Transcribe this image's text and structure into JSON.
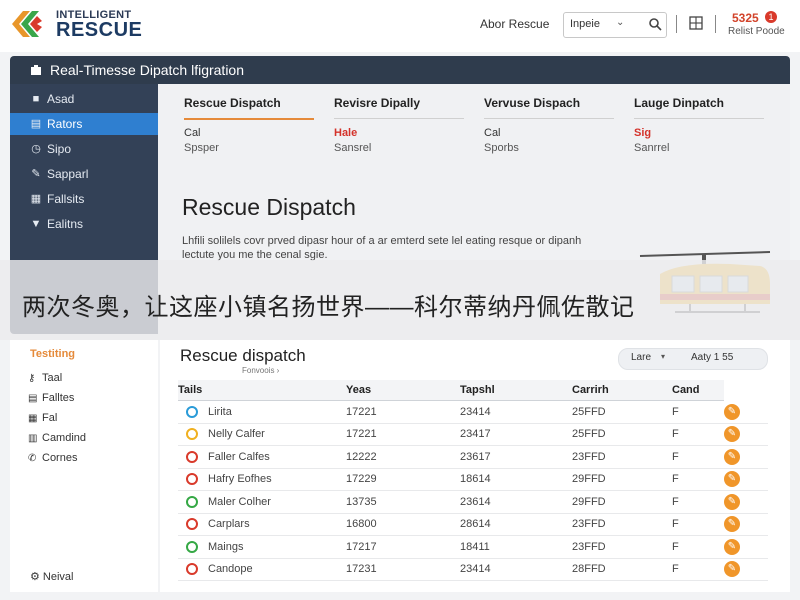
{
  "header": {
    "brand_top": "INTELLIGENT",
    "brand_main": "RESCUE",
    "about": "Abor Rescue",
    "search_select": "Inpeie",
    "stat_value": "5325",
    "stat_badge": "1",
    "stat_sub": "Relist Poode"
  },
  "panel": {
    "title": "Real-Timesse Dipatch lfigration"
  },
  "sidebar": {
    "items": [
      {
        "icon": "folder-icon",
        "glyph": "■",
        "label": "Asad"
      },
      {
        "icon": "dashboard-icon",
        "glyph": "▤",
        "label": "Rators"
      },
      {
        "icon": "clock-icon",
        "glyph": "◷",
        "label": "Sipo"
      },
      {
        "icon": "wrench-icon",
        "glyph": "✎",
        "label": "Sapparl"
      },
      {
        "icon": "chart-icon",
        "glyph": "▦",
        "label": "Fallsits"
      },
      {
        "icon": "filter-icon",
        "glyph": "▼",
        "label": "Ealitns"
      }
    ]
  },
  "columns": [
    {
      "title": "Rescue Dispatch",
      "line1": "Cal",
      "line2": "Spsper"
    },
    {
      "title": "Revisre Dipally",
      "line1": "Hale",
      "line2": "Sansrel"
    },
    {
      "title": "Vervuse Dispach",
      "line1": "Cal",
      "line2": "Sporbs"
    },
    {
      "title": "Lauge Dinpatch",
      "line1": "Sig",
      "line2": "Sanrrel"
    }
  ],
  "hero": {
    "title": "Rescue Dispatch",
    "text": "Lhfili solilels covr prved dipasr hour of a ar emterd sete lel eating resque or dipanh lectute you me the cenal sgie."
  },
  "caption": "两次冬奥，让这座小镇名扬世界——科尔蒂纳丹佩佐散记",
  "side2": {
    "title": "Testiting",
    "items": [
      {
        "icon": "key-icon",
        "glyph": "⚷",
        "label": "Taal"
      },
      {
        "icon": "list-icon",
        "glyph": "▤",
        "label": "Falltes"
      },
      {
        "icon": "grid-icon",
        "glyph": "▦",
        "label": "Fal"
      },
      {
        "icon": "calendar-icon",
        "glyph": "▥",
        "label": "Camdind"
      },
      {
        "icon": "phone-icon",
        "glyph": "✆",
        "label": "Cornes"
      }
    ],
    "footer": "Neival",
    "footer_icon": "settings-icon"
  },
  "table": {
    "title": "Rescue dispatch",
    "subtitle": "Fonvoois ›",
    "filter_a": "Lare",
    "filter_b": "▾",
    "filter_c": "Aaty 1 55",
    "headers": [
      "Tails",
      "Yeas",
      "Tapshl",
      "Carrirh",
      "Cand"
    ],
    "rows": [
      {
        "status_color": "#2a9bd8",
        "name": "Lirita",
        "c2": "17221",
        "c3": "23414",
        "c4": "25FFD",
        "c5": "F"
      },
      {
        "status_color": "#f0b020",
        "name": "Nelly Calfer",
        "c2": "17221",
        "c3": "23417",
        "c4": "25FFD",
        "c5": "F"
      },
      {
        "status_color": "#d93a2b",
        "name": "Faller Calfes",
        "c2": "12222",
        "c3": "23617",
        "c4": "23FFD",
        "c5": "F"
      },
      {
        "status_color": "#d93a2b",
        "name": "Hafry Eofhes",
        "c2": "17229",
        "c3": "18614",
        "c4": "29FFD",
        "c5": "F"
      },
      {
        "status_color": "#35a845",
        "name": "Maler Colher",
        "c2": "13735",
        "c3": "23614",
        "c4": "29FFD",
        "c5": "F"
      },
      {
        "status_color": "#d93a2b",
        "name": "Carplars",
        "c2": "16800",
        "c3": "28614",
        "c4": "23FFD",
        "c5": "F"
      },
      {
        "status_color": "#35a845",
        "name": "Maings",
        "c2": "17217",
        "c3": "18411",
        "c4": "23FFD",
        "c5": "F"
      },
      {
        "status_color": "#d93a2b",
        "name": "Candope",
        "c2": "17231",
        "c3": "23414",
        "c4": "28FFD",
        "c5": "F"
      }
    ],
    "action_glyph": "✎"
  },
  "colors": {
    "accent": "#e58a3a",
    "sidebar": "#334157",
    "active": "#2f7fd0",
    "header_bar": "#2f3c4d"
  }
}
